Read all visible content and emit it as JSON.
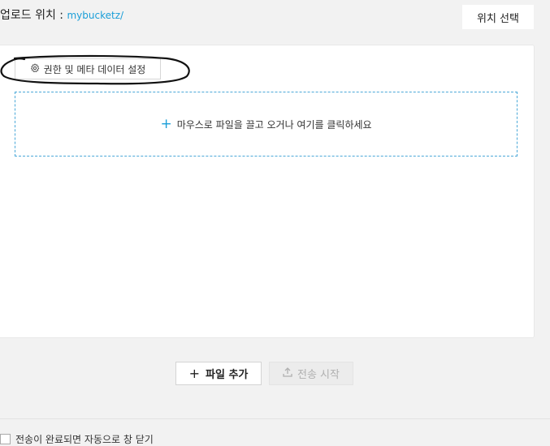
{
  "header": {
    "location_label": "업로드 위치 : ",
    "location_path": "mybucketz/",
    "select_location_label": "위치 선택"
  },
  "panel": {
    "permissions_button_label": "권한 및 메타 데이터 설정",
    "drop_zone_text": "마우스로 파일을 끌고 오거나 여기를 클릭하세요"
  },
  "actions": {
    "add_file_label": "파일 추가",
    "start_transfer_label": "전송 시작"
  },
  "footer": {
    "auto_close_label": "전송이 완료되면 자동으로 창 닫기",
    "auto_close_checked": false
  },
  "colors": {
    "accent": "#1a9ed8",
    "background": "#f2f2f2",
    "panel": "#ffffff",
    "disabled_text": "#b0b0b0"
  },
  "icons": {
    "permissions": "gear-icon",
    "drop_zone": "plus-icon",
    "add_file": "plus-icon",
    "start_transfer": "upload-icon"
  }
}
